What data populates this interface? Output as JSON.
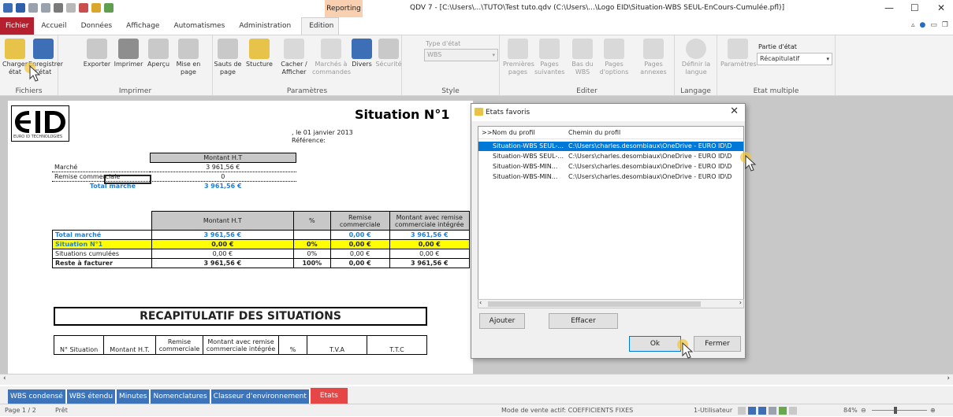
{
  "window": {
    "context_tab_label": "Reporting",
    "title": "QDV 7 - [C:\\Users\\...\\TUTO\\Test tuto.qdv  (C:\\Users\\...\\Logo EID\\Situation-WBS SEUL-EnCours-Cumulée.pfl)]"
  },
  "ribbon_tabs": [
    {
      "label": "Fichier"
    },
    {
      "label": "Accueil"
    },
    {
      "label": "Données"
    },
    {
      "label": "Affichage"
    },
    {
      "label": "Automatismes"
    },
    {
      "label": "Administration"
    },
    {
      "label": "Edition"
    }
  ],
  "ribbon": {
    "groups": {
      "fichiers": "Fichiers",
      "imprimer": "Imprimer",
      "parametres": "Paramètres",
      "style": "Style",
      "editer": "Editer",
      "langage": "Langage",
      "etat_multiple": "Etat multiple"
    },
    "buttons": {
      "charger": "Charger état",
      "enregistrer": "Enregistrer l'état",
      "exporter": "Exporter",
      "imprimer": "Imprimer",
      "apercu": "Aperçu",
      "mise_en_page": "Mise en page",
      "sauts_de_page": "Sauts de page",
      "stucture": "Stucture",
      "cacher_afficher": "Cacher / Afficher",
      "marches_commandes": "Marchés à commandes",
      "divers": "Divers",
      "securite": "Sécurité",
      "premieres_pages": "Premières pages",
      "pages_suivantes": "Pages suivantes",
      "bas_du_wbs": "Bas du WBS",
      "pages_d_options": "Pages d'options",
      "pages_annexes": "Pages annexes",
      "definir_la_langue": "Définir la langue",
      "parametres": "Paramètres"
    },
    "type_etat_label": "Type d'état",
    "type_etat_value": "WBS",
    "partie_etat_label": "Partie d'état",
    "partie_etat_value": "Récapitulatif"
  },
  "document": {
    "logo_text": "EURO ID TECHNOLOGIES",
    "title": "Situation N°1",
    "date": ", le 01 janvier 2013",
    "reference": "Référence:",
    "table1": {
      "header": "Montant H.T",
      "rows": [
        {
          "label": "Marché",
          "value": "3 961,56 €"
        },
        {
          "label": "Remise commerciale",
          "value": "0"
        }
      ],
      "total_label": "Total marché",
      "total_value": "3 961,56 €"
    },
    "table2": {
      "headers": [
        "Montant H.T",
        "%",
        "Remise commerciale",
        "Montant avec remise commerciale intégrée"
      ],
      "rows": [
        {
          "label": "Total marché",
          "values": [
            "3 961,56 €",
            "",
            "0,00 €",
            "3 961,56 €"
          ]
        },
        {
          "label": "Situation N°1",
          "values": [
            "0,00 €",
            "0%",
            "0,00 €",
            "0,00 €"
          ]
        },
        {
          "label": "Situations cumulées",
          "values": [
            "0,00 €",
            "0%",
            "0,00 €",
            "0,00 €"
          ]
        },
        {
          "label": "Reste à facturer",
          "values": [
            "3 961,56 €",
            "100%",
            "0,00 €",
            "3 961,56 €"
          ]
        }
      ]
    },
    "recap_title": "RECAPITULATIF DES SITUATIONS",
    "recap_headers": [
      "N° Situation",
      "Montant H.T.",
      "Remise commerciale",
      "Montant avec remise commerciale intégrée",
      "%",
      "T.V.A",
      "T.T.C"
    ]
  },
  "dialog": {
    "title": "Etats favoris",
    "col_name": ">>Nom du profil",
    "col_path": "Chemin du profil",
    "rows": [
      {
        "name": "Situation-WBS SEUL-...",
        "path": "C:\\Users\\charles.desombiaux\\OneDrive - EURO ID\\D"
      },
      {
        "name": "Situation-WBS SEUL-...",
        "path": "C:\\Users\\charles.desombiaux\\OneDrive - EURO ID\\D"
      },
      {
        "name": "Situation-WBS-MIN...",
        "path": "C:\\Users\\charles.desombiaux\\OneDrive - EURO ID\\D"
      },
      {
        "name": "Situation-WBS-MIN...",
        "path": "C:\\Users\\charles.desombiaux\\OneDrive - EURO ID\\D"
      }
    ],
    "btn_ajouter": "Ajouter",
    "btn_effacer": "Effacer",
    "btn_ok": "Ok",
    "btn_fermer": "Fermer"
  },
  "sheet_tabs": [
    {
      "label": "WBS condensé"
    },
    {
      "label": "WBS étendu"
    },
    {
      "label": "Minutes"
    },
    {
      "label": "Nomenclatures"
    },
    {
      "label": "Classeur d'environnement"
    },
    {
      "label": "Etats"
    }
  ],
  "status": {
    "page": "Page 1 / 2",
    "state": "Prêt",
    "mode": "Mode de vente actif:  COEFFICIENTS FIXES",
    "user": "1-Utilisateur",
    "zoom": "84%"
  },
  "colors": {
    "file_tab": "#b6202e",
    "accent": "#0078d7",
    "tab_blue": "#3c73b9",
    "tab_active": "#e64646",
    "highlight": "#ffff00",
    "total_blue": "#1f7fd6"
  }
}
